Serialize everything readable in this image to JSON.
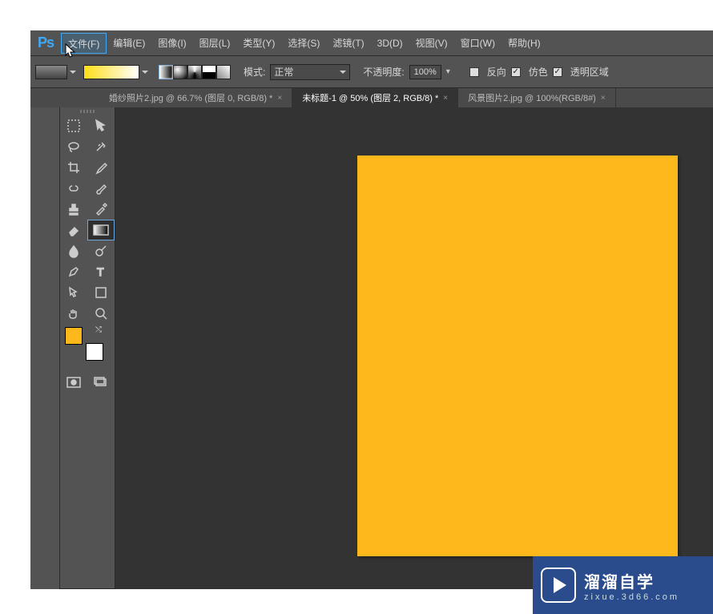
{
  "logo": "Ps",
  "menu": {
    "file": "文件(F)",
    "edit": "编辑(E)",
    "image": "图像(I)",
    "layer": "图层(L)",
    "type": "类型(Y)",
    "select": "选择(S)",
    "filter": "滤镜(T)",
    "threeD": "3D(D)",
    "view": "视图(V)",
    "window": "窗口(W)",
    "help": "帮助(H)"
  },
  "options": {
    "mode_label": "模式:",
    "mode_value": "正常",
    "opacity_label": "不透明度:",
    "opacity_value": "100%",
    "reverse": "反向",
    "dither": "仿色",
    "transparency": "透明区域"
  },
  "tabs": [
    {
      "label": "婚纱照片2.jpg @ 66.7% (图层 0, RGB/8) *",
      "active": false
    },
    {
      "label": "未标题-1 @ 50% (图层 2, RGB/8) *",
      "active": true
    },
    {
      "label": "风景图片2.jpg @ 100%(RGB/8#)",
      "active": false
    }
  ],
  "colors": {
    "foreground": "#ffb81c",
    "background": "#ffffff",
    "artboard": "#ffb81c",
    "canvas_bg": "#333333"
  },
  "watermark": {
    "title": "溜溜自学",
    "url": "zixue.3d66.com"
  },
  "tools": {
    "marquee": "marquee",
    "move": "move",
    "lasso": "lasso",
    "wand": "wand",
    "crop": "crop",
    "eyedropper": "eyedropper",
    "heal": "heal",
    "brush": "brush",
    "stamp": "stamp",
    "history": "history",
    "eraser": "eraser",
    "gradient": "gradient",
    "blur": "blur",
    "dodge": "dodge",
    "pen": "pen",
    "type": "type",
    "path": "path",
    "shape": "shape",
    "hand": "hand",
    "zoom": "zoom"
  }
}
